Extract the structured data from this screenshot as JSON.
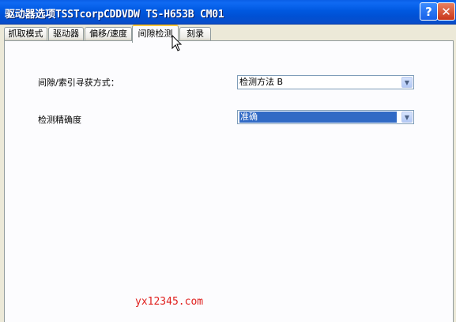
{
  "window": {
    "title": "驱动器选项TSSTcorpCDDVDW TS-H653B CM01",
    "help_glyph": "?",
    "close_glyph": "✕"
  },
  "tabs": [
    {
      "label": "抓取模式",
      "active": false
    },
    {
      "label": "驱动器",
      "active": false
    },
    {
      "label": "偏移/速度",
      "active": false
    },
    {
      "label": "间隙检测",
      "active": true
    },
    {
      "label": "刻录",
      "active": false
    }
  ],
  "fields": {
    "gap_method": {
      "label": "间隙/索引寻获方式：",
      "value": "检测方法 B"
    },
    "accuracy": {
      "label": "检测精确度",
      "value": "准确"
    }
  },
  "watermark": "yx12345.com",
  "icons": {
    "combo_arrow": "chevron-down-icon",
    "cursor": "mouse-cursor-icon"
  },
  "colors": {
    "title_bar": "#0058E0",
    "selection": "#316AC5",
    "active_tab_accent": "#FFC83C",
    "watermark": "#E0201E"
  }
}
